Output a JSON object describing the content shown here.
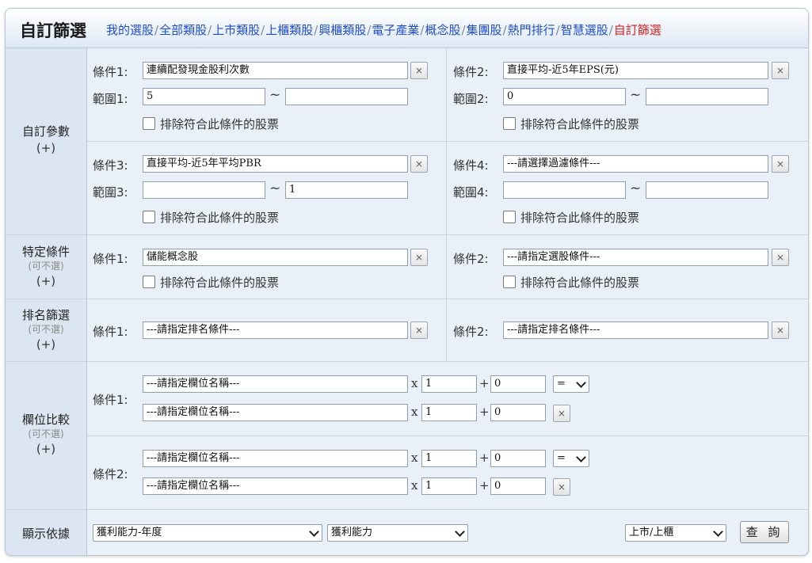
{
  "header": {
    "title": "自訂篩選",
    "nav": [
      "我的選股",
      "全部類股",
      "上市類股",
      "上櫃類股",
      "興櫃類股",
      "電子產業",
      "概念股",
      "集團股",
      "熱門排行",
      "智慧選股",
      "自訂篩選"
    ]
  },
  "custom_params": {
    "label": "自訂參數",
    "plus": "(+)",
    "cond_label_1": "條件1:",
    "cond_label_2": "條件2:",
    "cond_label_3": "條件3:",
    "cond_label_4": "條件4:",
    "range_label_1": "範圍1:",
    "range_label_2": "範圍2:",
    "range_label_3": "範圍3:",
    "range_label_4": "範圍4:",
    "tilde": "~",
    "exclude": "排除符合此條件的股票",
    "cond1": {
      "value": "連續配發現金股利次數",
      "min": "5",
      "max": ""
    },
    "cond2": {
      "value": "直接平均-近5年EPS(元)",
      "min": "0",
      "max": ""
    },
    "cond3": {
      "value": "直接平均-近5年平均PBR",
      "min": "",
      "max": "1"
    },
    "cond4": {
      "value": "---請選擇過濾條件---",
      "min": "",
      "max": ""
    }
  },
  "specific": {
    "label": "特定條件",
    "optional": "(可不選)",
    "plus": "(+)",
    "cond_label_1": "條件1:",
    "cond_label_2": "條件2:",
    "cond1": "儲能概念股",
    "cond2": "---請指定選股條件---",
    "exclude": "排除符合此條件的股票"
  },
  "ranking": {
    "label": "排名篩選",
    "optional": "(可不選)",
    "plus": "(+)",
    "cond_label_1": "條件1:",
    "cond_label_2": "條件2:",
    "cond1": "---請指定排名條件---",
    "cond2": "---請指定排名條件---"
  },
  "compare": {
    "label": "欄位比較",
    "optional": "(可不選)",
    "plus": "(+)",
    "cond_label_1": "條件1:",
    "cond_label_2": "條件2:",
    "field_placeholder": "---請指定欄位名稱---",
    "x": "x",
    "plus_op": "+",
    "mult": "1",
    "add": "0",
    "operator": "="
  },
  "display": {
    "label": "顯示依據",
    "select1": "獲利能力-年度",
    "select2": "獲利能力",
    "market": "上市/上櫃",
    "query": "查 詢"
  },
  "close_glyph": "×"
}
